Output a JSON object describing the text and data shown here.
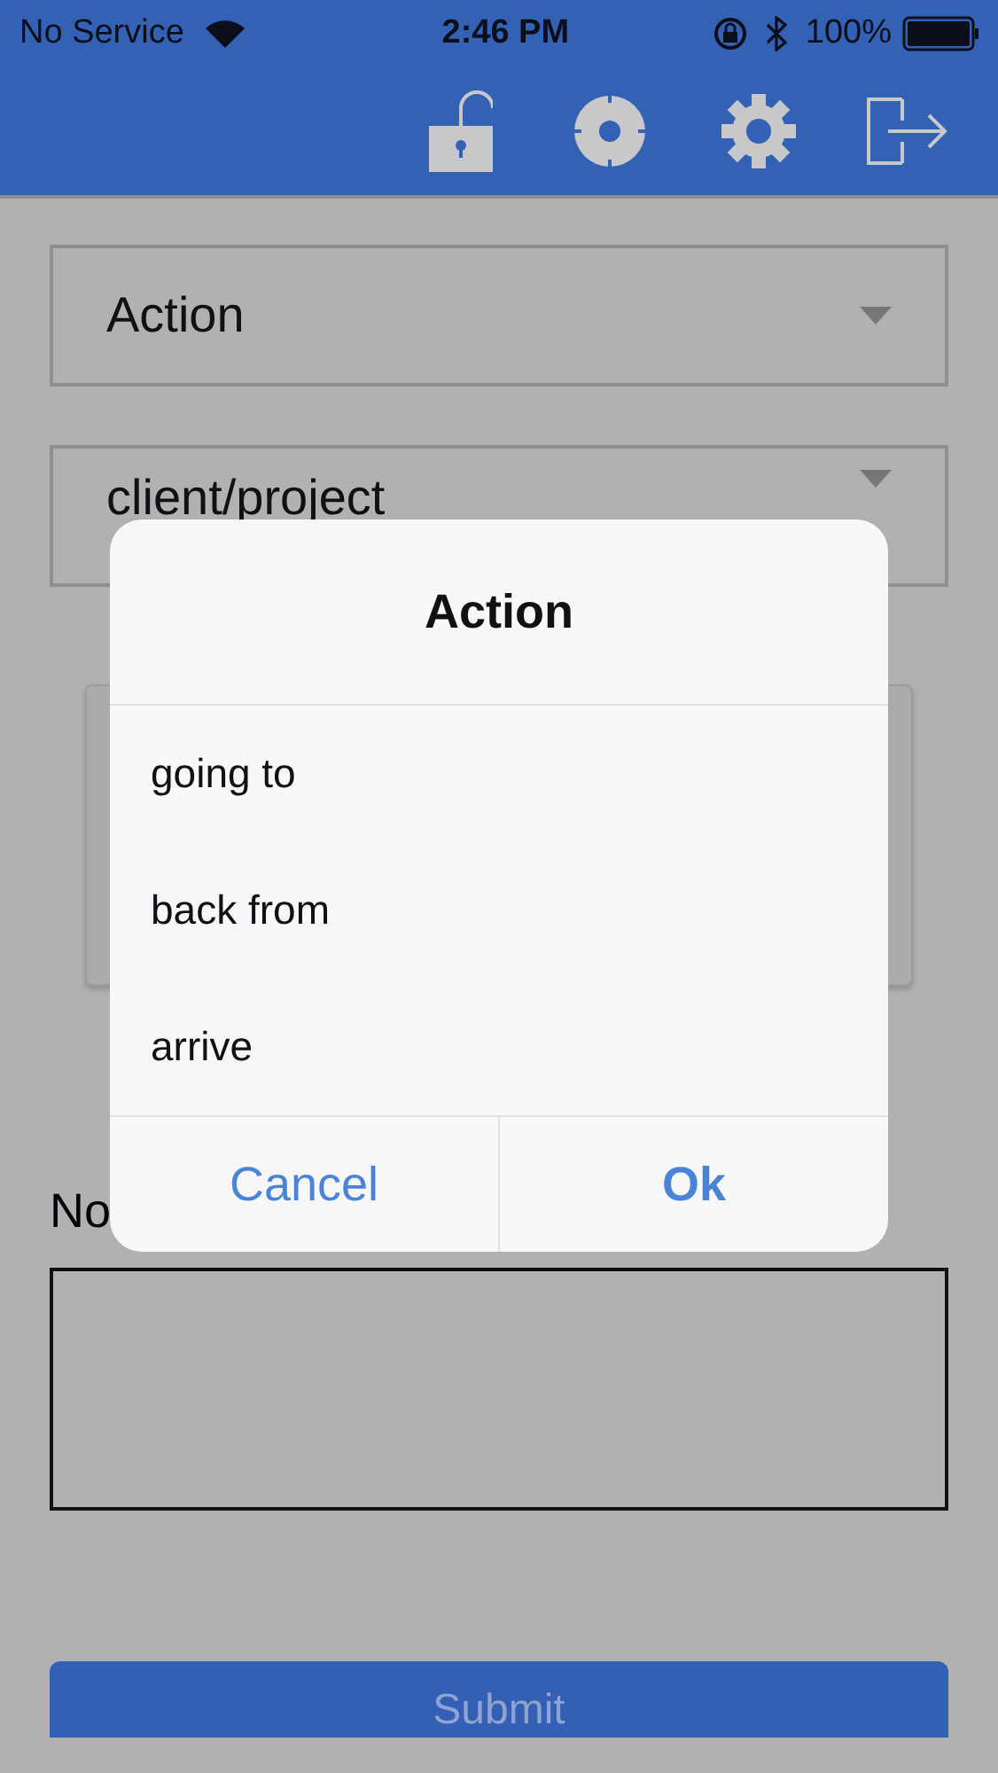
{
  "status_bar": {
    "carrier": "No Service",
    "time": "2:46 PM",
    "battery": "100%"
  },
  "toolbar": {
    "buttons": [
      {
        "kind": "unlock"
      },
      {
        "kind": "locate"
      },
      {
        "kind": "settings"
      },
      {
        "kind": "logout"
      }
    ]
  },
  "form": {
    "action_select": {
      "value": "Action"
    },
    "client_select": {
      "value": "client/project"
    },
    "notes_label": "No",
    "submit": "Submit"
  },
  "dialog": {
    "title": "Action",
    "options": [
      {
        "label": "going to"
      },
      {
        "label": "back from"
      },
      {
        "label": "arrive"
      }
    ],
    "buttons": [
      {
        "label": "Cancel",
        "kind": "cancel"
      },
      {
        "label": "Ok",
        "kind": "confirm"
      }
    ]
  }
}
